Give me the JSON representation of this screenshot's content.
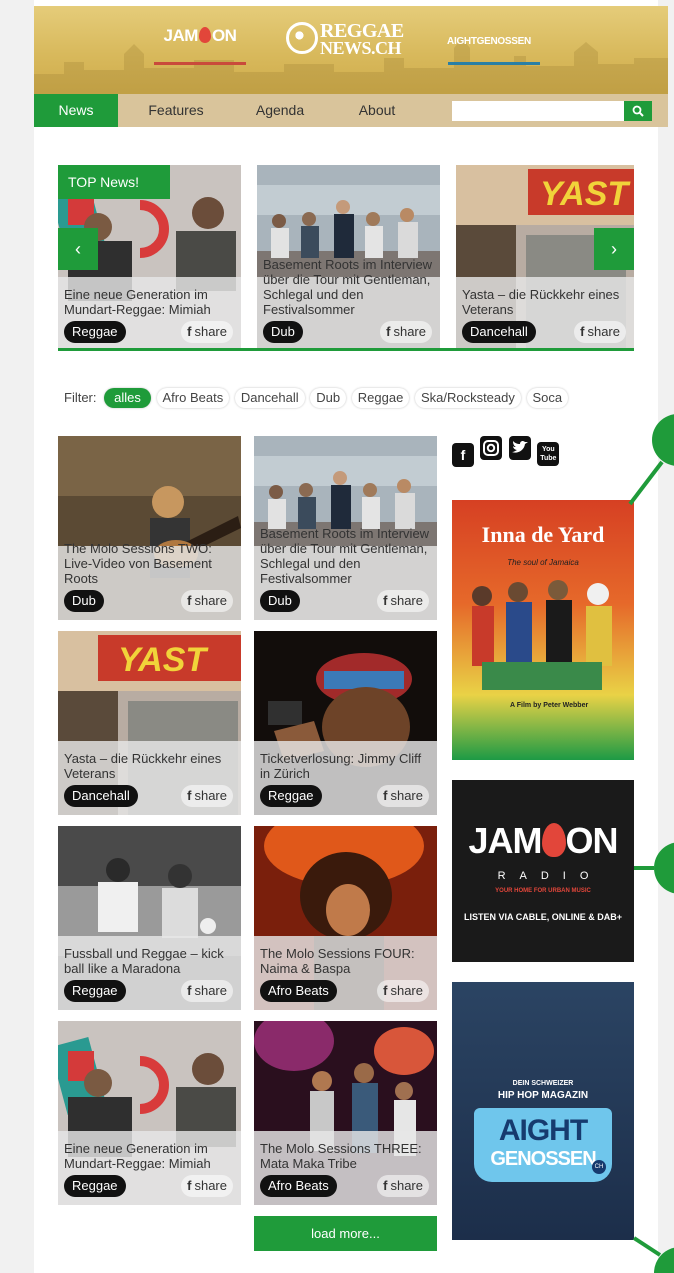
{
  "header": {
    "brand_jam": "JAM",
    "brand_jam_suffix": "ON",
    "brand_reggae_line1": "REGGAE",
    "brand_reggae_line2": "NEWS.CH",
    "brand_aight": "AIGHTGENOSSEN"
  },
  "nav": {
    "items": [
      "News",
      "Features",
      "Agenda",
      "About"
    ],
    "search_placeholder": ""
  },
  "slider": {
    "badge": "TOP News!",
    "prev": "‹",
    "next": "›",
    "cards": [
      {
        "title": "Eine neue Generation im Mundart-Reggae: Mimiah",
        "tag": "Reggae",
        "share": "share"
      },
      {
        "title": "Basement Roots im Interview über die Tour mit Gentleman, Schlegal und den Festivalsommer",
        "tag": "Dub",
        "share": "share"
      },
      {
        "title": "Yasta – die Rückkehr eines Veterans",
        "tag": "Dancehall",
        "share": "share"
      }
    ]
  },
  "filter": {
    "label": "Filter:",
    "options": [
      "alles",
      "Afro Beats",
      "Dancehall",
      "Dub",
      "Reggae",
      "Ska/Rocksteady",
      "Soca"
    ]
  },
  "grid": {
    "cards": [
      {
        "title": "The Molo Sessions TWO: Live-Video von Basement Roots",
        "tag": "Dub",
        "share": "share"
      },
      {
        "title": "Basement Roots im Interview über die Tour mit Gentleman, Schlegal und den Festivalsommer",
        "tag": "Dub",
        "share": "share"
      },
      {
        "title": "Yasta – die Rückkehr eines Veterans",
        "tag": "Dancehall",
        "share": "share"
      },
      {
        "title": "Ticketverlosung: Jimmy Cliff in Zürich",
        "tag": "Reggae",
        "share": "share"
      },
      {
        "title": "Fussball und Reggae – kick ball like a Maradona",
        "tag": "Reggae",
        "share": "share"
      },
      {
        "title": "The Molo Sessions FOUR: Naima & Baspa",
        "tag": "Afro Beats",
        "share": "share"
      },
      {
        "title": "Eine neue Generation im Mundart-Reggae: Mimiah",
        "tag": "Reggae",
        "share": "share"
      },
      {
        "title": "The Molo Sessions THREE: Mata Maka Tribe",
        "tag": "Afro Beats",
        "share": "share"
      }
    ],
    "load_more": "load more..."
  },
  "social": {
    "facebook": "f",
    "youtube_top": "You",
    "youtube_bottom": "Tube"
  },
  "ads": {
    "inna_title": "Inna de Yard",
    "inna_sub": "The soul of Jamaica",
    "inna_credits": "A Film by Peter Webber",
    "jam_word": "JAM",
    "jam_suffix": "ON",
    "jam_radio": "RADIO",
    "jam_home": "YOUR HOME FOR URBAN MUSIC",
    "jam_listen": "LISTEN VIA CABLE, ONLINE & DAB+",
    "aight_pre1": "DEIN SCHWEIZER",
    "aight_pre2": "HIP HOP MAGAZIN",
    "aight_a": "AIGHT",
    "aight_b": "GENOSSEN",
    "aight_ch": "CH"
  },
  "colors": {
    "accent": "#1f9b3a",
    "header": "#d8b95c",
    "nav": "#d9c49b",
    "tag": "#111111"
  }
}
